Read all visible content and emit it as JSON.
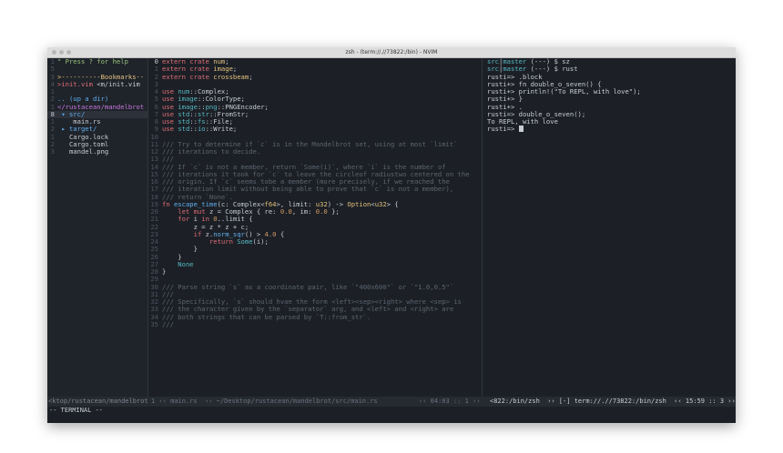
{
  "window": {
    "title": "zsh - (term://.//73822:/bin) - NVIM"
  },
  "tree": [
    {
      "n": "1",
      "segs": [
        [
          "\" Press ? for help",
          "c-grn"
        ]
      ]
    },
    {
      "n": "5",
      "segs": []
    },
    {
      "n": "3",
      "segs": [
        [
          ">----------Bookmarks--",
          "c-bm"
        ]
      ]
    },
    {
      "n": "4",
      "segs": [
        [
          ">init.vim ",
          "c-red"
        ],
        [
          "<m/init.vim",
          "c-txt"
        ]
      ]
    },
    {
      "n": "1",
      "segs": []
    },
    {
      "n": "2",
      "segs": [
        [
          ".. (up a dir)",
          "c-blu"
        ]
      ]
    },
    {
      "n": "1",
      "segs": [
        [
          "</rustacean/mandelbrot",
          "c-pur"
        ]
      ]
    },
    {
      "n": "8",
      "cur": true,
      "sel": true,
      "segs": [
        [
          " ▾ src/",
          "c-blu"
        ]
      ]
    },
    {
      "n": "1",
      "segs": [
        [
          "    main.rs",
          "c-txt"
        ]
      ]
    },
    {
      "n": "2",
      "segs": [
        [
          " ▸ target/",
          "c-blu"
        ]
      ]
    },
    {
      "n": "1",
      "segs": [
        [
          "   Cargo.lock",
          "c-txt"
        ]
      ]
    },
    {
      "n": "2",
      "segs": [
        [
          "   Cargo.toml",
          "c-txt"
        ]
      ]
    },
    {
      "n": "3",
      "segs": [
        [
          "   mandel.png",
          "c-txt"
        ]
      ]
    }
  ],
  "code": [
    {
      "n": "0",
      "cur": true,
      "segs": [
        [
          "extern crate ",
          "c-red"
        ],
        [
          "num",
          "c-ylw"
        ],
        [
          ";",
          "c-txt"
        ]
      ]
    },
    {
      "n": "1",
      "segs": [
        [
          "extern crate ",
          "c-red"
        ],
        [
          "image",
          "c-ylw"
        ],
        [
          ";",
          "c-txt"
        ]
      ]
    },
    {
      "n": "2",
      "segs": [
        [
          "extern crate ",
          "c-red"
        ],
        [
          "crossbeam",
          "c-ylw"
        ],
        [
          ";",
          "c-txt"
        ]
      ]
    },
    {
      "n": "3",
      "segs": []
    },
    {
      "n": "4",
      "segs": [
        [
          "use ",
          "c-red"
        ],
        [
          "num",
          "c-cyn"
        ],
        [
          "::Complex;",
          "c-txt"
        ]
      ]
    },
    {
      "n": "5",
      "segs": [
        [
          "use ",
          "c-red"
        ],
        [
          "image",
          "c-cyn"
        ],
        [
          "::ColorType;",
          "c-txt"
        ]
      ]
    },
    {
      "n": "6",
      "segs": [
        [
          "use ",
          "c-red"
        ],
        [
          "image",
          "c-cyn"
        ],
        [
          "::",
          "c-txt"
        ],
        [
          "png",
          "c-cyn"
        ],
        [
          "::PNGEncoder;",
          "c-txt"
        ]
      ]
    },
    {
      "n": "7",
      "segs": [
        [
          "use ",
          "c-red"
        ],
        [
          "std",
          "c-cyn"
        ],
        [
          "::",
          "c-txt"
        ],
        [
          "str",
          "c-cyn"
        ],
        [
          "::FromStr;",
          "c-txt"
        ]
      ]
    },
    {
      "n": "8",
      "segs": [
        [
          "use ",
          "c-red"
        ],
        [
          "std",
          "c-cyn"
        ],
        [
          "::",
          "c-txt"
        ],
        [
          "fs",
          "c-cyn"
        ],
        [
          "::File;",
          "c-txt"
        ]
      ]
    },
    {
      "n": "9",
      "segs": [
        [
          "use ",
          "c-red"
        ],
        [
          "std",
          "c-cyn"
        ],
        [
          "::",
          "c-txt"
        ],
        [
          "io",
          "c-cyn"
        ],
        [
          "::Write;",
          "c-txt"
        ]
      ]
    },
    {
      "n": "10",
      "segs": []
    },
    {
      "n": "11",
      "segs": [
        [
          "/// Try to determine if `c` is in the Mandelbrot set, using at most `limit`",
          "c-com"
        ]
      ]
    },
    {
      "n": "12",
      "segs": [
        [
          "/// iterations to decide.",
          "c-com"
        ]
      ]
    },
    {
      "n": "13",
      "segs": [
        [
          "///",
          "c-com"
        ]
      ]
    },
    {
      "n": "14",
      "segs": [
        [
          "/// If `c` is not a member, return `Some(i)`, where `i` is the number of",
          "c-com"
        ]
      ]
    },
    {
      "n": "15",
      "segs": [
        [
          "/// iterations it took for `c` to leave the circleof radiustwo centered on the",
          "c-com"
        ]
      ]
    },
    {
      "n": "16",
      "segs": [
        [
          "/// origin. If `c` seems tobe a member (more precisely, if we reached the",
          "c-com"
        ]
      ]
    },
    {
      "n": "17",
      "segs": [
        [
          "/// iteration limit without being able to prove that `c` is not a member),",
          "c-com"
        ]
      ]
    },
    {
      "n": "18",
      "segs": [
        [
          "/// return `None`.",
          "c-com"
        ]
      ]
    },
    {
      "n": "19",
      "segs": [
        [
          "fn ",
          "c-red"
        ],
        [
          "escape_time",
          "c-blu"
        ],
        [
          "(c: Complex<",
          "c-txt"
        ],
        [
          "f64",
          "c-ylw"
        ],
        [
          ">, limit: ",
          "c-txt"
        ],
        [
          "u32",
          "c-ylw"
        ],
        [
          ") -> ",
          "c-txt"
        ],
        [
          "Option",
          "c-ylw"
        ],
        [
          "<",
          "c-txt"
        ],
        [
          "u32",
          "c-ylw"
        ],
        [
          "> {",
          "c-txt"
        ]
      ]
    },
    {
      "n": "20",
      "segs": [
        [
          "    let mut ",
          "c-red"
        ],
        [
          "z = Complex { re: ",
          "c-txt"
        ],
        [
          "0.0",
          "c-org"
        ],
        [
          ", im: ",
          "c-txt"
        ],
        [
          "0.0",
          "c-org"
        ],
        [
          " };",
          "c-txt"
        ]
      ]
    },
    {
      "n": "21",
      "segs": [
        [
          "    for ",
          "c-red"
        ],
        [
          "i ",
          "c-txt"
        ],
        [
          "in ",
          "c-red"
        ],
        [
          "0",
          "c-org"
        ],
        [
          "..limit {",
          "c-txt"
        ]
      ]
    },
    {
      "n": "22",
      "segs": [
        [
          "        z = z * z + c;",
          "c-txt"
        ]
      ]
    },
    {
      "n": "23",
      "segs": [
        [
          "        if ",
          "c-red"
        ],
        [
          "z.",
          "c-txt"
        ],
        [
          "norm_sqr",
          "c-blu"
        ],
        [
          "() > ",
          "c-txt"
        ],
        [
          "4.0",
          "c-org"
        ],
        [
          " {",
          "c-txt"
        ]
      ]
    },
    {
      "n": "24",
      "segs": [
        [
          "            return ",
          "c-red"
        ],
        [
          "Some",
          "c-cyn"
        ],
        [
          "(i);",
          "c-txt"
        ]
      ]
    },
    {
      "n": "25",
      "segs": [
        [
          "        }",
          "c-txt"
        ]
      ]
    },
    {
      "n": "26",
      "segs": [
        [
          "    }",
          "c-txt"
        ]
      ]
    },
    {
      "n": "27",
      "segs": [
        [
          "    None",
          "c-cyn"
        ]
      ]
    },
    {
      "n": "28",
      "segs": [
        [
          "}",
          "c-txt"
        ]
      ]
    },
    {
      "n": "29",
      "segs": []
    },
    {
      "n": "30",
      "segs": [
        [
          "/// Parse string `s` as a coordinate pair, like `\"400x600\"` or `\"1.0,0.5\"`",
          "c-com"
        ]
      ]
    },
    {
      "n": "31",
      "segs": [
        [
          "///",
          "c-com"
        ]
      ]
    },
    {
      "n": "32",
      "segs": [
        [
          "/// Specifically, `s` should hvae the form <left><sep><right> where <sep> is",
          "c-com"
        ]
      ]
    },
    {
      "n": "33",
      "segs": [
        [
          "/// the character given by the `separator` arg, and <left> and <right> are",
          "c-com"
        ]
      ]
    },
    {
      "n": "34",
      "segs": [
        [
          "/// both strings that can be parsed by `T::from_str`.",
          "c-com"
        ]
      ]
    },
    {
      "n": "35",
      "segs": [
        [
          "///",
          "c-com"
        ]
      ]
    }
  ],
  "terminal": [
    {
      "segs": [
        [
          "src",
          "c-cyn"
        ],
        [
          "|",
          "c-txt"
        ],
        [
          "master",
          "c-cyn"
        ],
        [
          " (---) $ sz",
          "c-txt"
        ]
      ]
    },
    {
      "segs": [
        [
          "src",
          "c-cyn"
        ],
        [
          "|",
          "c-txt"
        ],
        [
          "master",
          "c-cyn"
        ],
        [
          " (---) $ rust",
          "c-txt"
        ]
      ]
    },
    {
      "segs": [
        [
          "rusti=> .block",
          "c-txt"
        ]
      ]
    },
    {
      "segs": [
        [
          "rusti+> fn double_o_seven() {",
          "c-txt"
        ]
      ]
    },
    {
      "segs": [
        [
          "rusti+> println!(\"To REPL, with love\");",
          "c-txt"
        ]
      ]
    },
    {
      "segs": [
        [
          "rusti+> }",
          "c-txt"
        ]
      ]
    },
    {
      "segs": [
        [
          "rusti+> .",
          "c-txt"
        ]
      ]
    },
    {
      "segs": [
        [
          "rusti=> double_o_seven();",
          "c-txt"
        ]
      ]
    },
    {
      "segs": [
        [
          "To REPL, with love",
          "c-txt"
        ]
      ]
    },
    {
      "segs": [
        [
          "rusti=> ",
          "c-txt"
        ]
      ],
      "cursor": true
    }
  ],
  "status": {
    "tree_path": "<ktop/rustacean/mandelbrot",
    "editor_file": "1 ‹‹ main.rs  ›› ~/Desktop/rustacean/mandelbrot/src/main.rs",
    "editor_pos": "‹‹ 04:03 :: 1 ››",
    "term": "<822:/bin/zsh  ›› [-] term://.//73822:/bin/zsh  ‹‹ 15:59 :: 3 ››"
  },
  "cmdline": "-- TERMINAL --"
}
